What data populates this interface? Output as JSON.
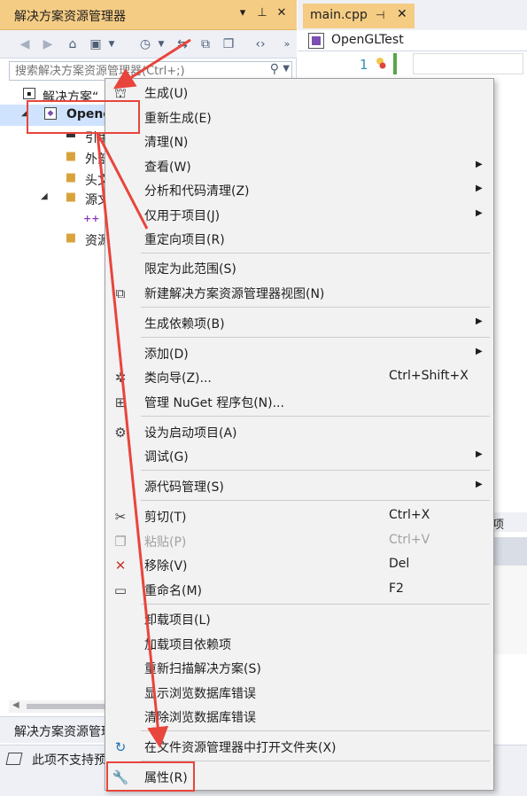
{
  "solution_explorer": {
    "title": "解决方案资源管理器",
    "title_controls": {
      "dropdown": "▾",
      "pin": "⊥",
      "close": "✕"
    },
    "toolbar_overflow": "»",
    "search_placeholder": "搜索解决方案资源管理器(Ctrl+;)",
    "tree": [
      {
        "label": "解决方案“",
        "icon": "solution-icon"
      },
      {
        "label": "Openc",
        "icon": "project-icon"
      },
      {
        "label": "引用",
        "icon": "references-icon"
      },
      {
        "label": "外部",
        "icon": "external-deps-icon"
      },
      {
        "label": "头文",
        "icon": "folder-icon"
      },
      {
        "label": "源文",
        "icon": "folder-icon"
      },
      {
        "label": "",
        "icon": "cpp-file-icon"
      },
      {
        "label": "资源",
        "icon": "folder-icon"
      }
    ],
    "bottom_tab": "解决方案资源管理"
  },
  "status_bar": {
    "text": "此项不支持预"
  },
  "editor": {
    "tab_label": "main.cpp",
    "nav_project": "OpenGLTest",
    "line_number": "1",
    "lower_fragment": "项"
  },
  "context_menu": {
    "items": [
      {
        "label": "生成(U)",
        "icon": "build-icon"
      },
      {
        "label": "重新生成(E)"
      },
      {
        "label": "清理(N)"
      },
      {
        "label": "查看(W)",
        "submenu": true
      },
      {
        "label": "分析和代码清理(Z)",
        "submenu": true
      },
      {
        "label": "仅用于项目(J)",
        "submenu": true
      },
      {
        "label": "重定向项目(R)"
      },
      {
        "label": "限定为此范围(S)"
      },
      {
        "label": "新建解决方案资源管理器视图(N)",
        "icon": "new-view-icon"
      },
      {
        "label": "生成依赖项(B)",
        "submenu": true
      },
      {
        "label": "添加(D)",
        "submenu": true
      },
      {
        "label": "类向导(Z)...",
        "shortcut": "Ctrl+Shift+X",
        "icon": "class-wizard-icon"
      },
      {
        "label": "管理 NuGet 程序包(N)...",
        "icon": "nuget-icon"
      },
      {
        "label": "设为启动项目(A)",
        "icon": "gear-icon"
      },
      {
        "label": "调试(G)",
        "submenu": true
      },
      {
        "label": "源代码管理(S)",
        "submenu": true
      },
      {
        "label": "剪切(T)",
        "shortcut": "Ctrl+X",
        "icon": "scissors-icon"
      },
      {
        "label": "粘贴(P)",
        "shortcut": "Ctrl+V",
        "icon": "paste-icon",
        "disabled": true
      },
      {
        "label": "移除(V)",
        "shortcut": "Del",
        "icon": "remove-icon"
      },
      {
        "label": "重命名(M)",
        "shortcut": "F2",
        "icon": "rename-icon"
      },
      {
        "label": "卸载项目(L)"
      },
      {
        "label": "加载项目依赖项"
      },
      {
        "label": "重新扫描解决方案(S)"
      },
      {
        "label": "显示浏览数据库错误"
      },
      {
        "label": "清除浏览数据库错误"
      },
      {
        "label": "在文件资源管理器中打开文件夹(X)",
        "icon": "open-folder-icon"
      },
      {
        "label": "属性(R)",
        "icon": "wrench-icon"
      }
    ]
  },
  "colors": {
    "title_bar": "#f5cc84",
    "selection": "#cfe3ff",
    "menu_bg": "#f2f2f2",
    "annotation": "#e8453c"
  }
}
